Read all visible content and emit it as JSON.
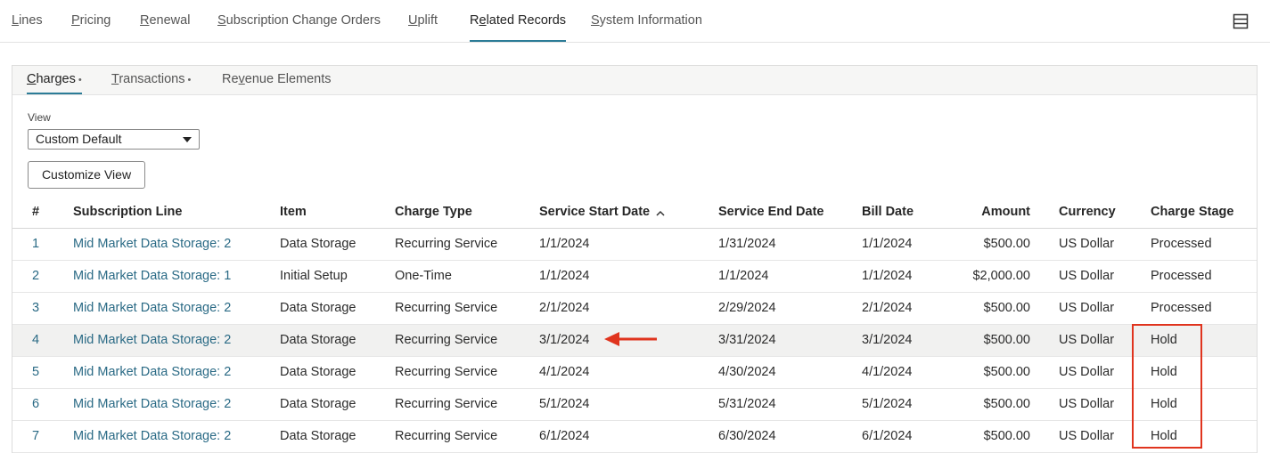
{
  "top_tabs": [
    {
      "pre": "",
      "key": "L",
      "post": "ines",
      "active": false
    },
    {
      "pre": "",
      "key": "P",
      "post": "ricing",
      "active": false
    },
    {
      "pre": "",
      "key": "R",
      "post": "enewal",
      "active": false
    },
    {
      "pre": "",
      "key": "S",
      "post": "ubscription Change Orders",
      "active": false
    },
    {
      "pre": "",
      "key": "U",
      "post": "plift",
      "active": false
    },
    {
      "pre": "R",
      "key": "e",
      "post": "lated Records",
      "active": true
    },
    {
      "pre": "",
      "key": "S",
      "post": "ystem Information",
      "active": false
    }
  ],
  "sub_tabs": [
    {
      "pre": "",
      "key": "C",
      "post": "harges",
      "dot": "•",
      "active": true
    },
    {
      "pre": "",
      "key": "T",
      "post": "ransactions",
      "dot": "•",
      "active": false
    },
    {
      "pre": "Re",
      "key": "v",
      "post": "enue Elements",
      "dot": "",
      "active": false
    }
  ],
  "view": {
    "label": "View",
    "selected": "Custom Default"
  },
  "customize_button": "Customize View",
  "table": {
    "headers": {
      "num": "#",
      "line": "Subscription Line",
      "item": "Item",
      "type": "Charge Type",
      "start": "Service Start Date",
      "end": "Service End Date",
      "bill": "Bill Date",
      "amount": "Amount",
      "currency": "Currency",
      "stage": "Charge Stage"
    },
    "sort": {
      "column": "start",
      "direction": "ascending"
    },
    "rows": [
      {
        "num": "1",
        "line": "Mid Market Data Storage: 2",
        "item": "Data Storage",
        "type": "Recurring Service",
        "start": "1/1/2024",
        "end": "1/31/2024",
        "bill": "1/1/2024",
        "amount": "$500.00",
        "currency": "US Dollar",
        "stage": "Processed"
      },
      {
        "num": "2",
        "line": "Mid Market Data Storage: 1",
        "item": "Initial Setup",
        "type": "One-Time",
        "start": "1/1/2024",
        "end": "1/1/2024",
        "bill": "1/1/2024",
        "amount": "$2,000.00",
        "currency": "US Dollar",
        "stage": "Processed"
      },
      {
        "num": "3",
        "line": "Mid Market Data Storage: 2",
        "item": "Data Storage",
        "type": "Recurring Service",
        "start": "2/1/2024",
        "end": "2/29/2024",
        "bill": "2/1/2024",
        "amount": "$500.00",
        "currency": "US Dollar",
        "stage": "Processed"
      },
      {
        "num": "4",
        "line": "Mid Market Data Storage: 2",
        "item": "Data Storage",
        "type": "Recurring Service",
        "start": "3/1/2024",
        "end": "3/31/2024",
        "bill": "3/1/2024",
        "amount": "$500.00",
        "currency": "US Dollar",
        "stage": "Hold",
        "highlight": true
      },
      {
        "num": "5",
        "line": "Mid Market Data Storage: 2",
        "item": "Data Storage",
        "type": "Recurring Service",
        "start": "4/1/2024",
        "end": "4/30/2024",
        "bill": "4/1/2024",
        "amount": "$500.00",
        "currency": "US Dollar",
        "stage": "Hold"
      },
      {
        "num": "6",
        "line": "Mid Market Data Storage: 2",
        "item": "Data Storage",
        "type": "Recurring Service",
        "start": "5/1/2024",
        "end": "5/31/2024",
        "bill": "5/1/2024",
        "amount": "$500.00",
        "currency": "US Dollar",
        "stage": "Hold"
      },
      {
        "num": "7",
        "line": "Mid Market Data Storage: 2",
        "item": "Data Storage",
        "type": "Recurring Service",
        "start": "6/1/2024",
        "end": "6/30/2024",
        "bill": "6/1/2024",
        "amount": "$500.00",
        "currency": "US Dollar",
        "stage": "Hold"
      }
    ]
  },
  "colors": {
    "active_tab_underline": "#2c7c97",
    "link": "#2a6a85",
    "annotation": "#e0341e",
    "highlight_row": "#f1f1f0"
  },
  "icons": {
    "menu": "hamburger-menu-icon",
    "sort": "sort-ascending-icon",
    "dropdown": "chevron-down-icon",
    "annotation_arrow": "arrow-left-icon"
  }
}
